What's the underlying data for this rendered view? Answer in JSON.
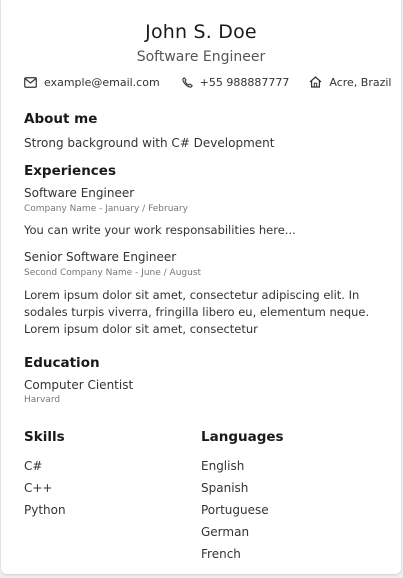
{
  "header": {
    "name": "John S. Doe",
    "role": "Software Engineer",
    "contacts": {
      "email": "example@email.com",
      "phone": "+55 988887777",
      "location": "Acre, Brazil"
    }
  },
  "about": {
    "title": "About me",
    "text": "Strong background with C# Development"
  },
  "experiences": {
    "title": "Experiences",
    "items": [
      {
        "position": "Software Engineer",
        "meta": "Company Name - January / February",
        "description": "You can write your work responsabilities here..."
      },
      {
        "position": "Senior Software Engineer",
        "meta": "Second Company Name - June / August",
        "description": "Lorem ipsum dolor sit amet, consectetur adipiscing elit. In sodales turpis viverra, fringilla libero eu, elementum neque. Lorem ipsum dolor sit amet, consectetur"
      }
    ]
  },
  "education": {
    "title": "Education",
    "degree": "Computer Cientist",
    "school": "Harvard"
  },
  "skills": {
    "title": "Skills",
    "items": [
      "C#",
      "C++",
      "Python"
    ]
  },
  "languages": {
    "title": "Languages",
    "items": [
      "English",
      "Spanish",
      "Portuguese",
      "German",
      "French"
    ]
  },
  "icons": {
    "email": "mail-icon",
    "phone": "phone-icon",
    "location": "home-icon"
  }
}
